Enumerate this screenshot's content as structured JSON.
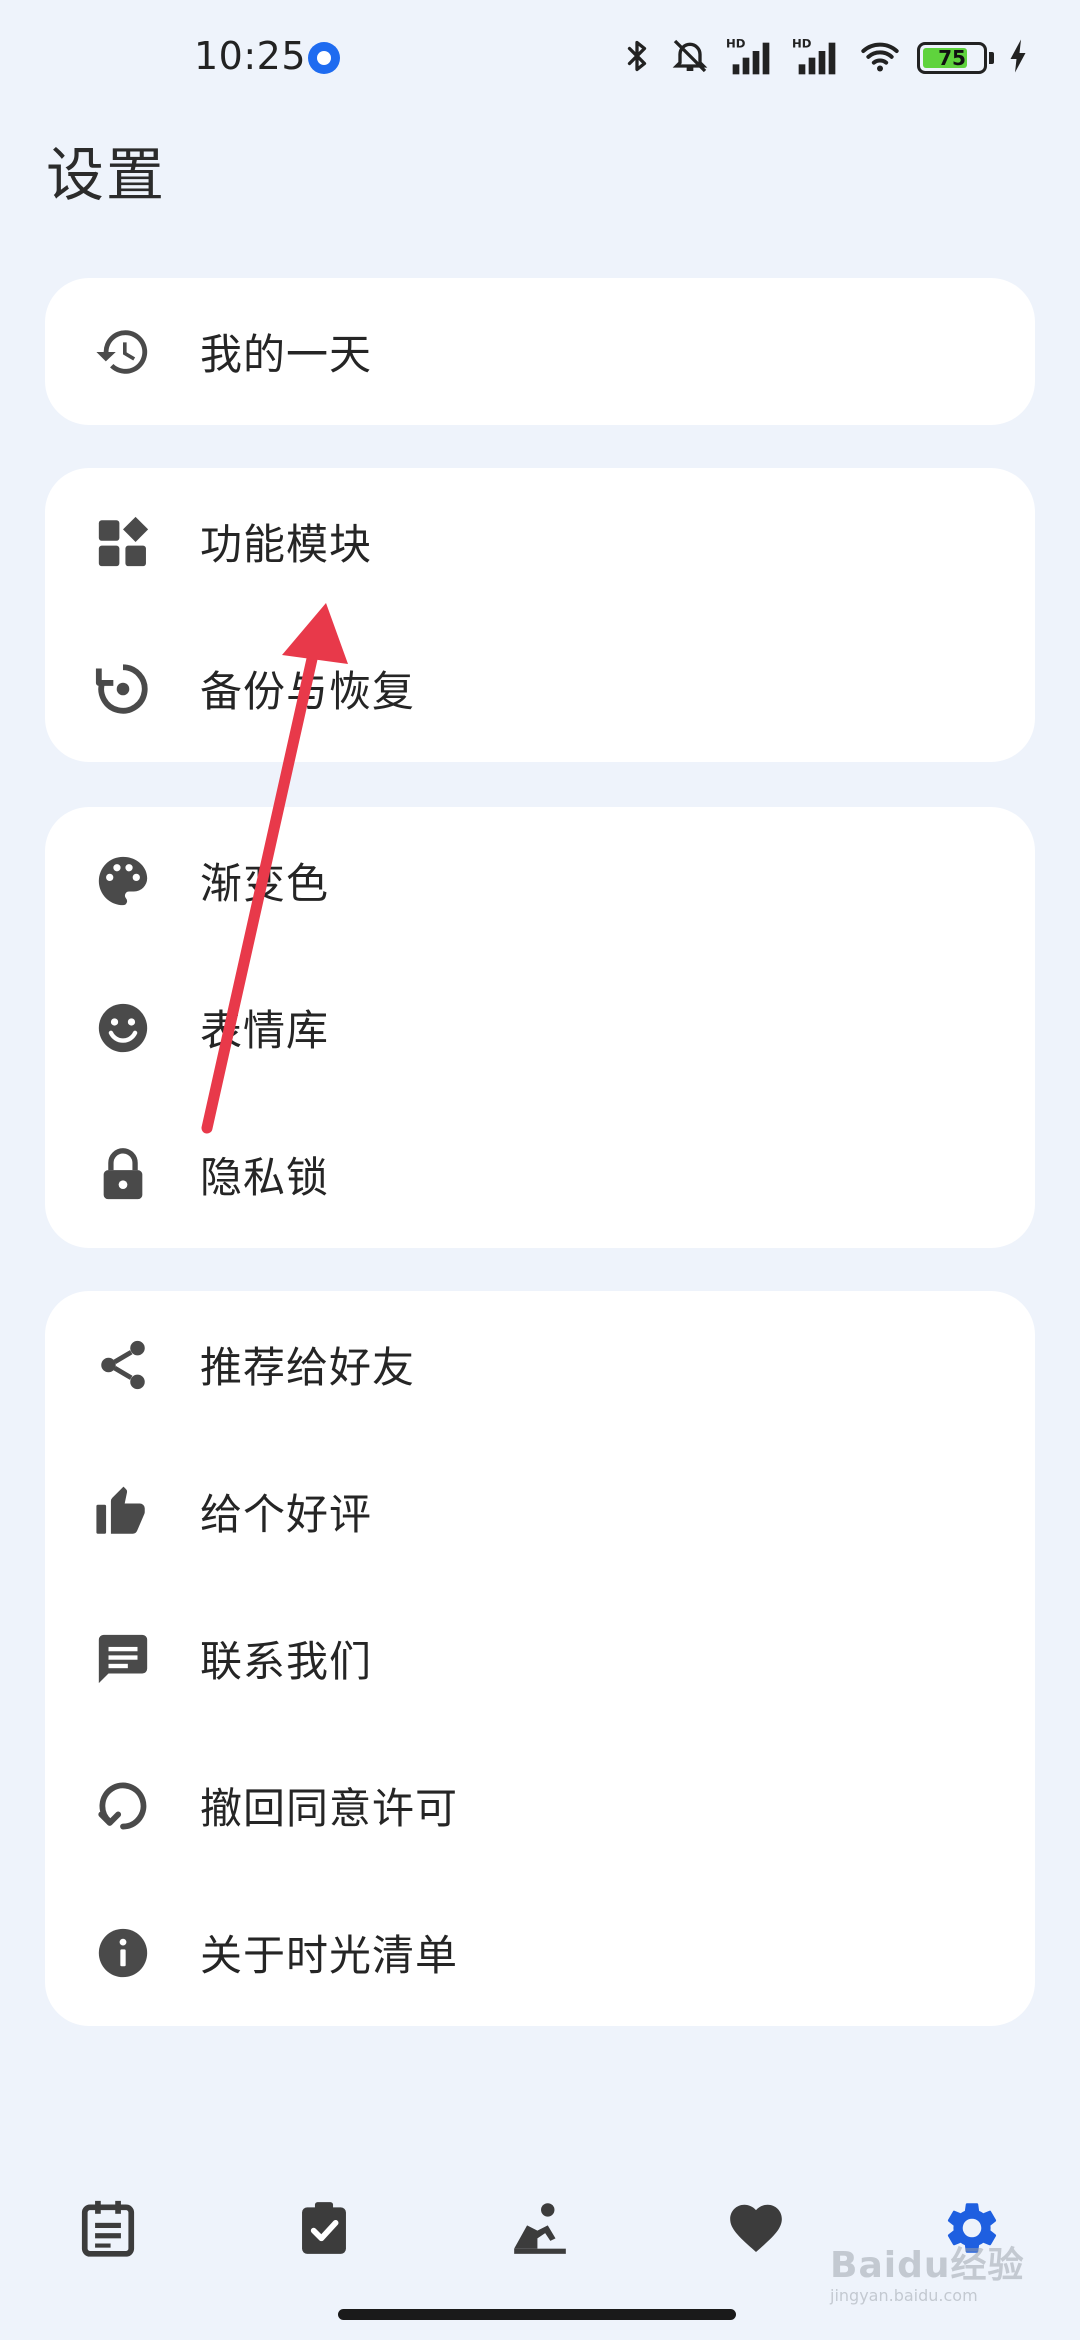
{
  "status_bar": {
    "time": "10:25",
    "battery_level": "75",
    "battery_fraction": 0.75,
    "icons": [
      "bluetooth-icon",
      "mute-icon",
      "signal-hd-icon",
      "signal-hd-icon",
      "wifi-icon",
      "battery-icon",
      "charging-icon"
    ],
    "battery_color": "#5FD33D"
  },
  "page": {
    "title": "设置"
  },
  "cards": [
    {
      "items": [
        {
          "label": "我的一天",
          "icon": "history-icon"
        }
      ]
    },
    {
      "items": [
        {
          "label": "功能模块",
          "icon": "widgets-icon"
        },
        {
          "label": "备份与恢复",
          "icon": "restore-icon"
        }
      ]
    },
    {
      "items": [
        {
          "label": "渐变色",
          "icon": "palette-icon"
        },
        {
          "label": "表情库",
          "icon": "emoji-icon"
        },
        {
          "label": "隐私锁",
          "icon": "lock-icon"
        }
      ]
    },
    {
      "items": [
        {
          "label": "推荐给好友",
          "icon": "share-icon"
        },
        {
          "label": "给个好评",
          "icon": "thumb-up-icon"
        },
        {
          "label": "联系我们",
          "icon": "chat-icon"
        },
        {
          "label": "撤回同意许可",
          "icon": "revoke-icon"
        },
        {
          "label": "关于时光清单",
          "icon": "info-icon"
        }
      ]
    }
  ],
  "bottom_nav": {
    "items": [
      {
        "icon": "calendar-note-icon",
        "active": false
      },
      {
        "icon": "checklist-icon",
        "active": false
      },
      {
        "icon": "meditation-icon",
        "active": false
      },
      {
        "icon": "heart-icon",
        "active": false
      },
      {
        "icon": "gear-icon",
        "active": true
      }
    ],
    "active_color": "#1E5FE0",
    "inactive_color": "#3c3c3c"
  },
  "watermark": {
    "text": "Baidu经验",
    "subtext": "jingyan.baidu.com"
  },
  "colors": {
    "background": "#EEF3FB",
    "card": "#FFFFFF",
    "icon": "#4A4A4A",
    "annotation": "#E8394A"
  }
}
